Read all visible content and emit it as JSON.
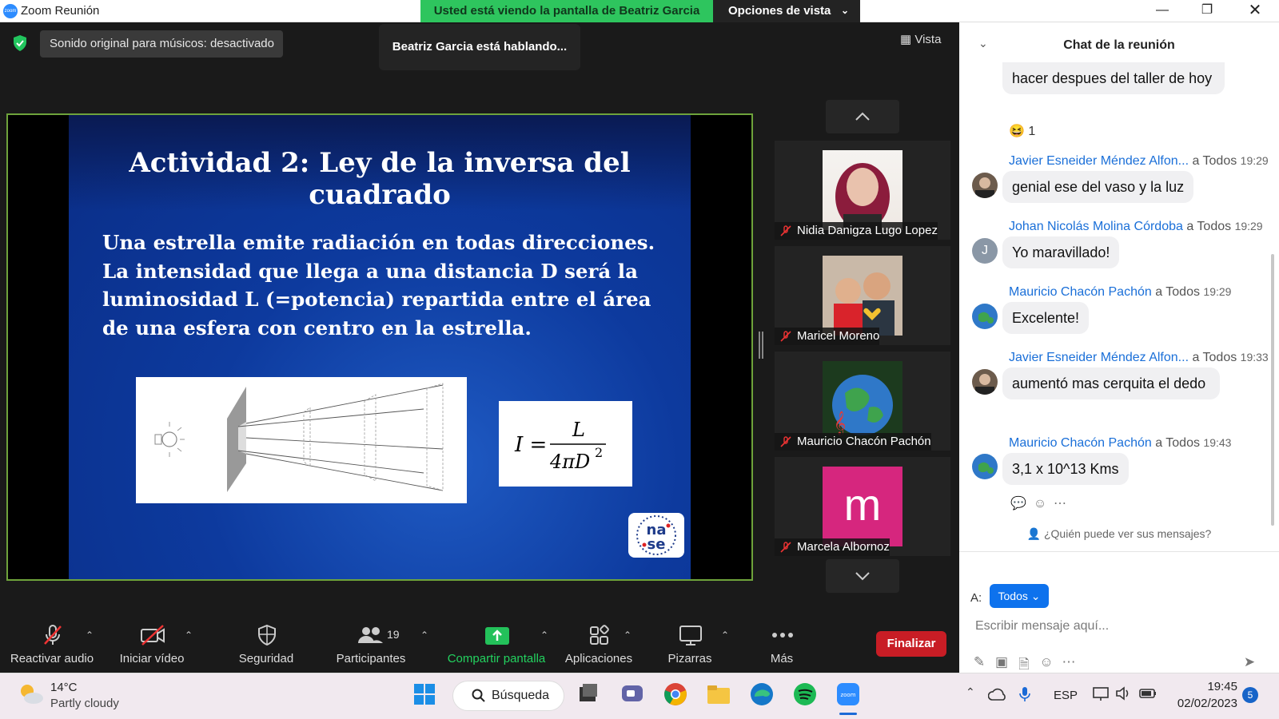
{
  "app": {
    "title": "Zoom Reunión",
    "logo_text": "zoom"
  },
  "banner": {
    "viewing": "Usted está viendo la pantalla de Beatriz Garcia",
    "view_options": "Opciones de vista"
  },
  "status": {
    "sound_chip": "Sonido original para músicos: desactivado",
    "speaking": "Beatriz Garcia está hablando...",
    "vista_label": "Vista"
  },
  "slide": {
    "title": "Actividad 2: Ley de la inversa del cuadrado",
    "body": "Una estrella emite radiación en todas direcciones. La intensidad que llega a una distancia D será la luminosidad L (=potencia) repartida entre el área de una esfera con centro en la estrella.",
    "formula_lhs": "I =",
    "formula_num": "L",
    "formula_den": "4πD",
    "formula_exp": "2",
    "logo_text": "nase"
  },
  "gallery": [
    {
      "name": "Nidia Danigza Lugo Lopez"
    },
    {
      "name": "Maricel Moreno"
    },
    {
      "name": "Mauricio Chacón Pachón"
    },
    {
      "name": "Marcela Albornoz",
      "initial": "m",
      "color": "#d6267e"
    }
  ],
  "toolbar": {
    "mute": "Reactivar audio",
    "video": "Iniciar vídeo",
    "security": "Seguridad",
    "participants": "Participantes",
    "participants_count": "19",
    "share": "Compartir pantalla",
    "apps": "Aplicaciones",
    "whiteboards": "Pizarras",
    "more": "Más",
    "end": "Finalizar"
  },
  "chat": {
    "title": "Chat de la reunión",
    "messages": [
      {
        "text": "hacer despues del taller de hoy"
      },
      {
        "sender": "Javier Esneider Méndez Alfon...",
        "to": "a Todos",
        "time": "19:29",
        "text": "genial ese del vaso y la luz"
      },
      {
        "sender": "Johan Nicolás Molina Córdoba",
        "to": "a Todos",
        "time": "19:29",
        "text": "Yo maravillado!",
        "avatar_initial": "J"
      },
      {
        "sender": "Mauricio Chacón Pachón",
        "to": "a Todos",
        "time": "19:29",
        "text": "Excelente!"
      },
      {
        "sender": "Javier Esneider Méndez Alfon...",
        "to": "a Todos",
        "time": "19:33",
        "text": "aumentó mas cerquita el dedo"
      },
      {
        "sender": "Mauricio Chacón Pachón",
        "to": "a Todos",
        "time": "19:43",
        "text": "3,1 x 10^13 Kms"
      }
    ],
    "reaction_count": "1",
    "who_can_see": "¿Quién puede ver sus mensajes?",
    "to_label": "A:",
    "to_value": "Todos",
    "input_placeholder": "Escribir mensaje aquí..."
  },
  "taskbar": {
    "temp": "14°C",
    "weather": "Partly cloudy",
    "search": "Búsqueda",
    "lang": "ESP",
    "time": "19:45",
    "date": "02/02/2023",
    "notifications": "5"
  }
}
